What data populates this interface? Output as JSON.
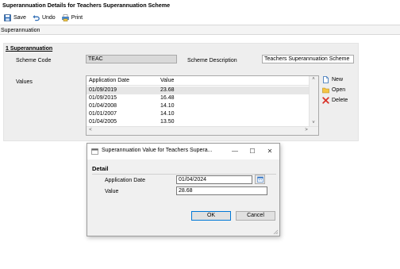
{
  "window": {
    "title": "Superannuation Details for Teachers Superannuation Scheme"
  },
  "toolbar": {
    "save": "Save",
    "undo": "Undo",
    "print": "Print"
  },
  "breadcrumb": "Superannuation",
  "section": {
    "number": "1",
    "title": "Superannuation",
    "scheme_code_label": "Scheme Code",
    "scheme_code_value": "TEAC",
    "scheme_description_label": "Scheme Description",
    "scheme_description_value": "Teachers Superannuation Scheme",
    "values_label": "Values"
  },
  "grid": {
    "columns": [
      "Application Date",
      "Value"
    ],
    "rows": [
      {
        "date": "01/09/2019",
        "value": "23.68"
      },
      {
        "date": "01/09/2015",
        "value": "16.48"
      },
      {
        "date": "01/04/2008",
        "value": "14.10"
      },
      {
        "date": "01/01/2007",
        "value": "14.10"
      },
      {
        "date": "01/04/2005",
        "value": "13.50"
      }
    ],
    "selected_row": 0
  },
  "side_buttons": {
    "new": "New",
    "open": "Open",
    "delete": "Delete"
  },
  "dialog": {
    "title": "Superannuation Value for Teachers Supera...",
    "detail_heading": "Detail",
    "application_date_label": "Application Date",
    "application_date_value": "01/04/2024",
    "value_label": "Value",
    "value_value": "28.68",
    "ok": "OK",
    "cancel": "Cancel"
  },
  "colors": {
    "accent": "#0078d7",
    "panel_bg": "#eeeeee",
    "delete_red": "#d9342b"
  }
}
